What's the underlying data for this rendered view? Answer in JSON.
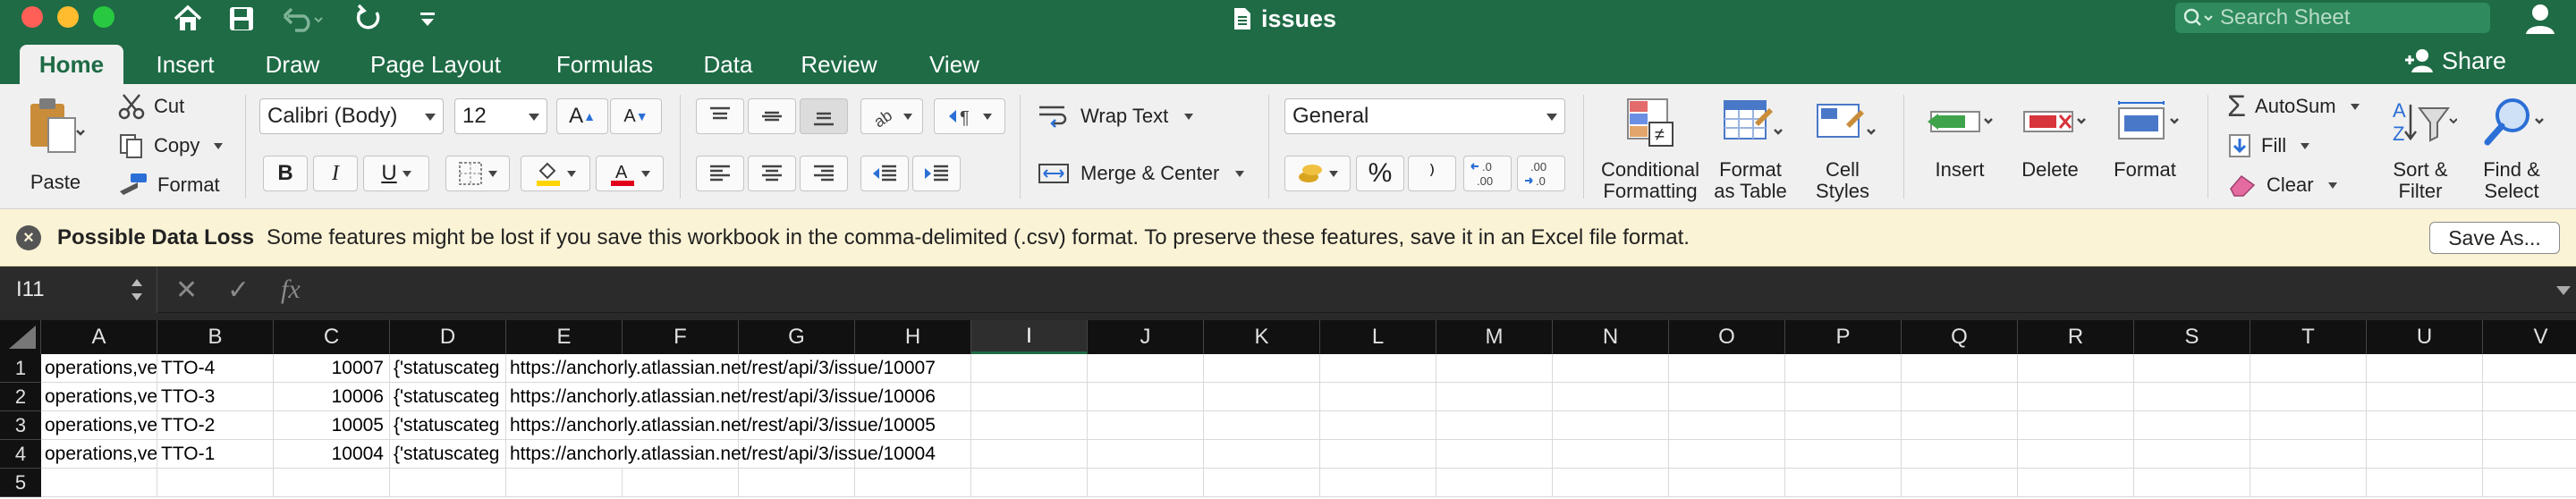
{
  "window": {
    "title": "issues",
    "search_placeholder": "Search Sheet"
  },
  "tabs": [
    "Home",
    "Insert",
    "Draw",
    "Page Layout",
    "Formulas",
    "Data",
    "Review",
    "View"
  ],
  "share_label": "Share",
  "ribbon": {
    "paste": "Paste",
    "cut": "Cut",
    "copy": "Copy",
    "format": "Format",
    "font_name": "Calibri (Body)",
    "font_size": "12",
    "bold": "B",
    "italic": "I",
    "underline": "U",
    "wrap_text": "Wrap Text",
    "merge_center": "Merge & Center",
    "number_format": "General",
    "percent": "%",
    "conditional_formatting_1": "Conditional",
    "conditional_formatting_2": "Formatting",
    "format_table_1": "Format",
    "format_table_2": "as Table",
    "cell_styles_1": "Cell",
    "cell_styles_2": "Styles",
    "insert": "Insert",
    "delete": "Delete",
    "format_cells": "Format",
    "autosum": "AutoSum",
    "fill": "Fill",
    "clear": "Clear",
    "sort_filter_1": "Sort &",
    "sort_filter_2": "Filter",
    "find_select_1": "Find &",
    "find_select_2": "Select",
    "colors": {
      "highlight": "#ffd400",
      "font_color": "#e0001b"
    }
  },
  "message_bar": {
    "title": "Possible Data Loss",
    "text": "Some features might be lost if you save this workbook in the comma-delimited (.csv) format. To preserve these features, save it in an Excel file format.",
    "button": "Save As..."
  },
  "formula_bar": {
    "name_box": "I11",
    "formula": "",
    "fx": "fx"
  },
  "grid": {
    "selected_column": "I",
    "columns": [
      "A",
      "B",
      "C",
      "D",
      "E",
      "F",
      "G",
      "H",
      "I",
      "J",
      "K",
      "L",
      "M",
      "N",
      "O",
      "P",
      "Q",
      "R",
      "S",
      "T",
      "U",
      "V"
    ],
    "row_numbers": [
      "1",
      "2",
      "3",
      "4",
      "5"
    ],
    "rows": [
      {
        "a": "operations,ve",
        "b": "TTO-4",
        "c": "10007",
        "d": "{'statuscateg",
        "e": "https://anchorly.atlassian.net/rest/api/3/issue/10007"
      },
      {
        "a": "operations,ve",
        "b": "TTO-3",
        "c": "10006",
        "d": "{'statuscateg",
        "e": "https://anchorly.atlassian.net/rest/api/3/issue/10006"
      },
      {
        "a": "operations,ve",
        "b": "TTO-2",
        "c": "10005",
        "d": "{'statuscateg",
        "e": "https://anchorly.atlassian.net/rest/api/3/issue/10005"
      },
      {
        "a": "operations,ve",
        "b": "TTO-1",
        "c": "10004",
        "d": "{'statuscateg",
        "e": "https://anchorly.atlassian.net/rest/api/3/issue/10004"
      }
    ]
  },
  "theme": {
    "brand_green": "#1e6b45",
    "warning_bg": "#fbf3d5"
  }
}
